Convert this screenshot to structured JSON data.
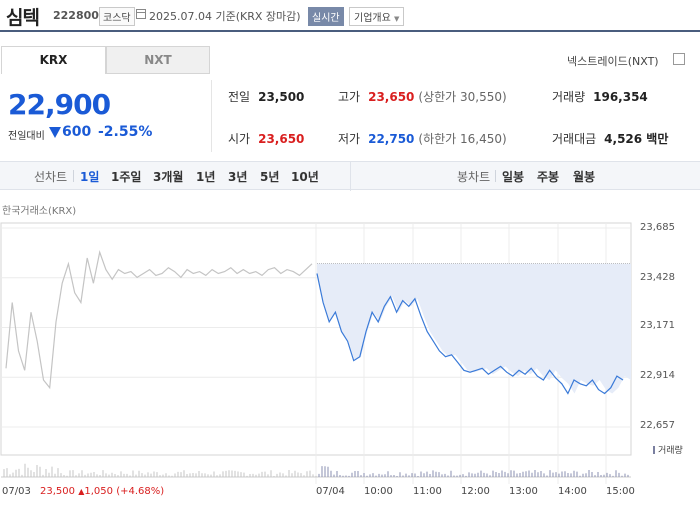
{
  "header": {
    "name": "심텍",
    "code": "222800",
    "market": "코스닥",
    "date": "2025.07.04 기준(KRX 장마감)",
    "realtime": "실시간",
    "company_info": "기업개요"
  },
  "tabs": {
    "krx": "KRX",
    "nxt": "NXT"
  },
  "nextrade_label": "넥스트레이드(NXT)",
  "price": {
    "current": "22,900",
    "change_label": "전일대비",
    "change": "600",
    "rate": "-2.55%",
    "direction": "down"
  },
  "stats": {
    "prev_label": "전일",
    "prev": "23,500",
    "high_label": "고가",
    "high": "23,650",
    "upper_limit": "(상한가 30,550)",
    "volume_label": "거래량",
    "volume": "196,354",
    "open_label": "시가",
    "open": "23,650",
    "low_label": "저가",
    "low": "22,750",
    "lower_limit": "(하한가 16,450)",
    "value_label": "거래대금",
    "value": "4,526 백만"
  },
  "period_bar": {
    "line_label": "선차트",
    "periods": [
      "1일",
      "1주일",
      "3개월",
      "1년",
      "3년",
      "5년",
      "10년"
    ],
    "selected": "1일",
    "candle_label": "봉차트",
    "candles": [
      "일봉",
      "주봉",
      "월봉"
    ]
  },
  "source_label": "한국거래소(KRX)",
  "chart_data": {
    "type": "line",
    "y_ticks": [
      "23,685",
      "23,428",
      "23,171",
      "22,914",
      "22,657"
    ],
    "ylim": [
      22657,
      23685
    ],
    "prev_close": 23500,
    "x_ticks": [
      "07/04",
      "10:00",
      "11:00",
      "12:00",
      "13:00",
      "14:00",
      "15:00"
    ],
    "volume_label": "거래량",
    "series_prev_day": [
      22960,
      23300,
      23050,
      22950,
      23250,
      23100,
      22900,
      22860,
      23200,
      23400,
      23500,
      23350,
      23300,
      23530,
      23400,
      23560,
      23470,
      23420,
      23470,
      23450,
      23460,
      23430,
      23450,
      23470,
      23440,
      23450,
      23480,
      23460,
      23430,
      23470,
      23450,
      23460,
      23440,
      23470,
      23450,
      23460,
      23480,
      23450,
      23470,
      23450,
      23460,
      23440,
      23470,
      23480,
      23450,
      23470,
      23460,
      23440,
      23470,
      23500
    ],
    "series_today": [
      23450,
      23300,
      23200,
      23250,
      23150,
      23100,
      23000,
      23020,
      23150,
      23250,
      23200,
      23280,
      23330,
      23250,
      23310,
      23280,
      23320,
      23230,
      23150,
      23100,
      23050,
      23020,
      23030,
      22990,
      22950,
      22940,
      22950,
      22960,
      22930,
      22950,
      22970,
      22940,
      22920,
      22950,
      22930,
      22960,
      22920,
      22900,
      22950,
      22910,
      22880,
      22830,
      22900,
      22880,
      22870,
      22900,
      22850,
      22830,
      22860,
      22920,
      22900
    ],
    "footer": {
      "date": "07/03",
      "close": "23,500",
      "change": "1,050",
      "rate": "(+4.68%)"
    }
  },
  "colors": {
    "up": "#d91f1f",
    "down": "#1a5ad6",
    "line_today": "#3a7ad8",
    "line_prev": "#c4c4c4",
    "fill": "#e6ecf8"
  }
}
